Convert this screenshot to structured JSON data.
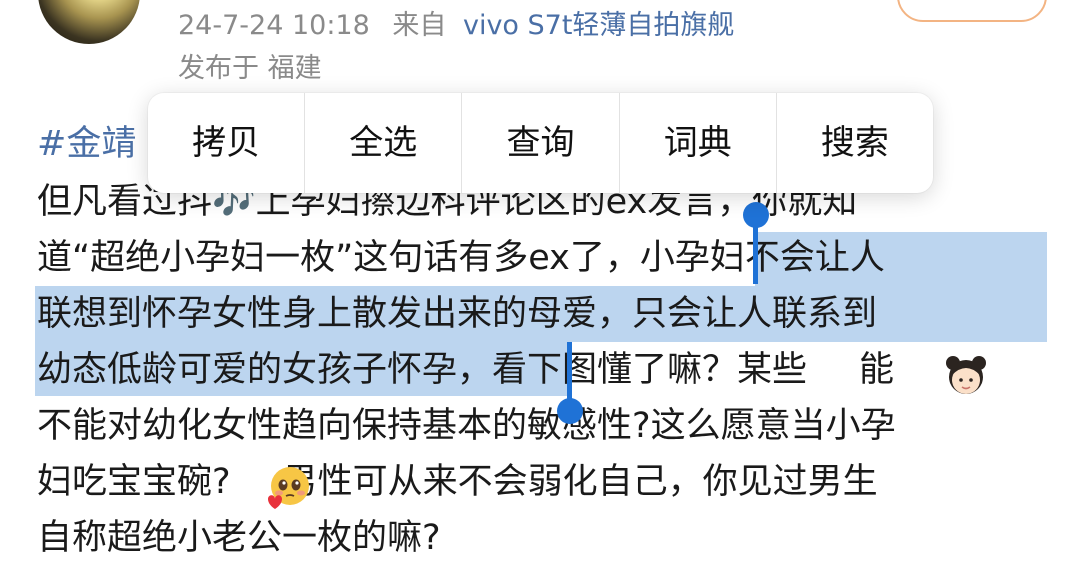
{
  "post": {
    "meta": {
      "datetime": "24-7-24 10:18",
      "from_prefix": "来自",
      "source": "vivo S7t轻薄自拍旗舰"
    },
    "location": "发布于 福建",
    "hashtag": "#金靖",
    "lines": [
      "但凡看过抖🎶上孕妇擦边科评论区的ex发言，你就知",
      "道“超绝小孕妇一枚”这句话有多ex了，",
      "小孕妇不会让人",
      "联想到怀孕女性身上散发出来的母爱，只会让人联系到",
      "幼态低龄可爱的女孩子怀孕，",
      "看下图懂了嘛？某些",
      "能",
      "不能对幼化女性趋向保持基本的敏感性?这么愿意当小孕",
      "妇吃宝宝碗?",
      "男性可从来不会弱化自己，你见过男生",
      "自称超绝小老公一枚的嘛?"
    ]
  },
  "context_menu": {
    "items": [
      "拷贝",
      "全选",
      "查询",
      "词典",
      "搜索"
    ]
  },
  "icons": {
    "emoji_1": "girl-emoji-icon",
    "emoji_2": "pleading-face-emoji-icon"
  },
  "colors": {
    "link": "#4a6fa6",
    "meta": "#8a8a8a",
    "selection": "#bcd5ef",
    "handle": "#1f72d6"
  }
}
